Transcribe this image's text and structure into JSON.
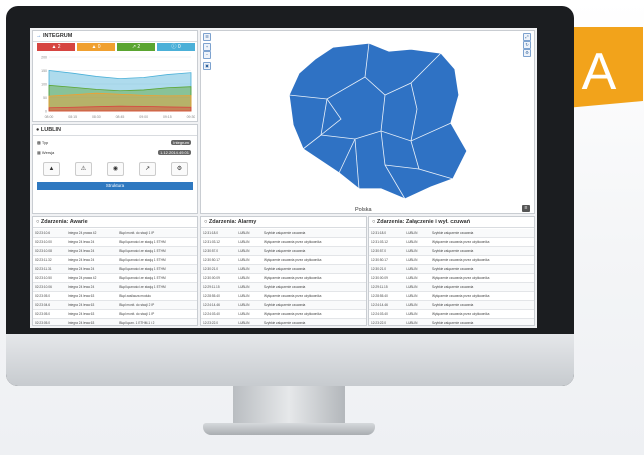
{
  "badge": {
    "letter": "A",
    "color": "#f2a31b"
  },
  "integrum": {
    "title": "INTEGRUM",
    "counters": [
      {
        "value": "2",
        "icon": "fire-icon",
        "color": "#d64541"
      },
      {
        "value": "0",
        "icon": "warning-icon",
        "color": "#f0a030"
      },
      {
        "value": "2",
        "icon": "wrench-icon",
        "color": "#5aa531"
      },
      {
        "value": "0",
        "icon": "info-icon",
        "color": "#4bb0d8"
      }
    ],
    "chart_data": {
      "type": "area",
      "x": [
        "08:00",
        "08:15",
        "08:30",
        "08:45",
        "09:00",
        "09:15",
        "09:30"
      ],
      "ylim": [
        0,
        200
      ],
      "yticks": [
        0,
        50,
        100,
        150,
        200
      ],
      "series": [
        {
          "color": "#d64541",
          "values": [
            12,
            14,
            16,
            18,
            17,
            15,
            14
          ]
        },
        {
          "color": "#f0a030",
          "values": [
            55,
            60,
            66,
            62,
            58,
            56,
            57
          ]
        },
        {
          "color": "#5aa531",
          "values": [
            95,
            88,
            80,
            75,
            78,
            86,
            90
          ]
        },
        {
          "color": "#4bb0d8",
          "values": [
            150,
            140,
            128,
            120,
            124,
            135,
            142
          ]
        }
      ]
    }
  },
  "lublin": {
    "title": "LUBLIN",
    "rows": [
      {
        "label": "Typ",
        "value": "Integrum"
      },
      {
        "label": "Wersja",
        "value": "1.12.2014.49.01"
      }
    ],
    "buttons": [
      "fire-icon",
      "warning-icon",
      "eye-icon",
      "wrench-icon",
      "gear-icon"
    ],
    "action_label": "Struktura"
  },
  "map": {
    "label": "Polska",
    "fill": "#2f72c4",
    "stroke": "#ffffff"
  },
  "tables": [
    {
      "title": "Zdarzenia: Awarie",
      "rows": [
        [
          "02:23:10.6",
          "Integra 24 prawa 42",
          "Błąd monit. do stacji 1 IP"
        ],
        [
          "02:23:10.00",
          "Integra 24 lewa 24",
          "Błąd łączności ze stacją 1 ETHM"
        ],
        [
          "02:23:10.08",
          "Integra 24 lewa 24",
          "Błąd łączności ze stacją 1 ETHM"
        ],
        [
          "02:23:11.32",
          "Integra 24 lewa 24",
          "Błąd łączności ze stacją 1 ETHM"
        ],
        [
          "02:23:11.31",
          "Integra 24 lewa 24",
          "Błąd łączności ze stacją 1 ETHM"
        ],
        [
          "02:23:10.50",
          "Integra 24 prawa 42",
          "Błąd łączności ze stacją 1 ETHM"
        ],
        [
          "02:23:10.06",
          "Integra 24 lewa 24",
          "Błąd łączności ze stacją 1 ETHM"
        ],
        [
          "02:23:05.0",
          "Integra 24 lewa 63",
          "Błąd zasilacza modułu"
        ],
        [
          "02:23:04.6",
          "Integra 24 lewa 63",
          "Błąd monit. do stacji 2 IP"
        ],
        [
          "02:23:05.0",
          "Integra 24 lewa 63",
          "Błąd monit. do stacji 1 IP"
        ],
        [
          "02:23:05.0",
          "Integra 24 lewa 63",
          "Błąd łączn. 1 ETHM-1 i 2"
        ]
      ]
    },
    {
      "title": "Zdarzenia: Alarmy",
      "rows": [
        [
          "12:31:18.0",
          "LUBLIN",
          "Szybkie załączenie czuwania"
        ],
        [
          "12:31:03.12",
          "LUBLIN",
          "Wyłączenie czuwania przez użytkownika"
        ],
        [
          "12:30:57.0",
          "LUBLIN",
          "Szybkie załączenie czuwania"
        ],
        [
          "12:30:50.17",
          "LUBLIN",
          "Wyłączenie czuwania przez użytkownika"
        ],
        [
          "12:30:21.0",
          "LUBLIN",
          "Szybkie załączenie czuwania"
        ],
        [
          "12:30:00.09",
          "LUBLIN",
          "Wyłączenie czuwania przez użytkownika"
        ],
        [
          "12:29:11.15",
          "LUBLIN",
          "Szybkie załączenie czuwania"
        ],
        [
          "12:28:55.40",
          "LUBLIN",
          "Wyłączenie czuwania przez użytkownika"
        ],
        [
          "12:24:14.46",
          "LUBLIN",
          "Szybkie załączenie czuwania"
        ],
        [
          "12:24:03.40",
          "LUBLIN",
          "Wyłączenie czuwania przez użytkownika"
        ],
        [
          "12:23:22.0",
          "LUBLIN",
          "Szybkie załączenie czuwania"
        ]
      ]
    },
    {
      "title": "Zdarzenia: Załączenie i wył. czuwań",
      "rows": [
        [
          "12:31:18.0",
          "LUBLIN",
          "Szybkie załączenie czuwania"
        ],
        [
          "12:31:03.12",
          "LUBLIN",
          "Wyłączenie czuwania przez użytkownika"
        ],
        [
          "12:30:57.0",
          "LUBLIN",
          "Szybkie załączenie czuwania"
        ],
        [
          "12:30:50.17",
          "LUBLIN",
          "Wyłączenie czuwania przez użytkownika"
        ],
        [
          "12:30:21.0",
          "LUBLIN",
          "Szybkie załączenie czuwania"
        ],
        [
          "12:30:00.09",
          "LUBLIN",
          "Wyłączenie czuwania przez użytkownika"
        ],
        [
          "12:29:11.15",
          "LUBLIN",
          "Szybkie załączenie czuwania"
        ],
        [
          "12:28:55.40",
          "LUBLIN",
          "Wyłączenie czuwania przez użytkownika"
        ],
        [
          "12:24:14.46",
          "LUBLIN",
          "Szybkie załączenie czuwania"
        ],
        [
          "12:24:03.40",
          "LUBLIN",
          "Wyłączenie czuwania przez użytkownika"
        ],
        [
          "12:23:22.0",
          "LUBLIN",
          "Szybkie załączenie czuwania"
        ]
      ]
    }
  ]
}
